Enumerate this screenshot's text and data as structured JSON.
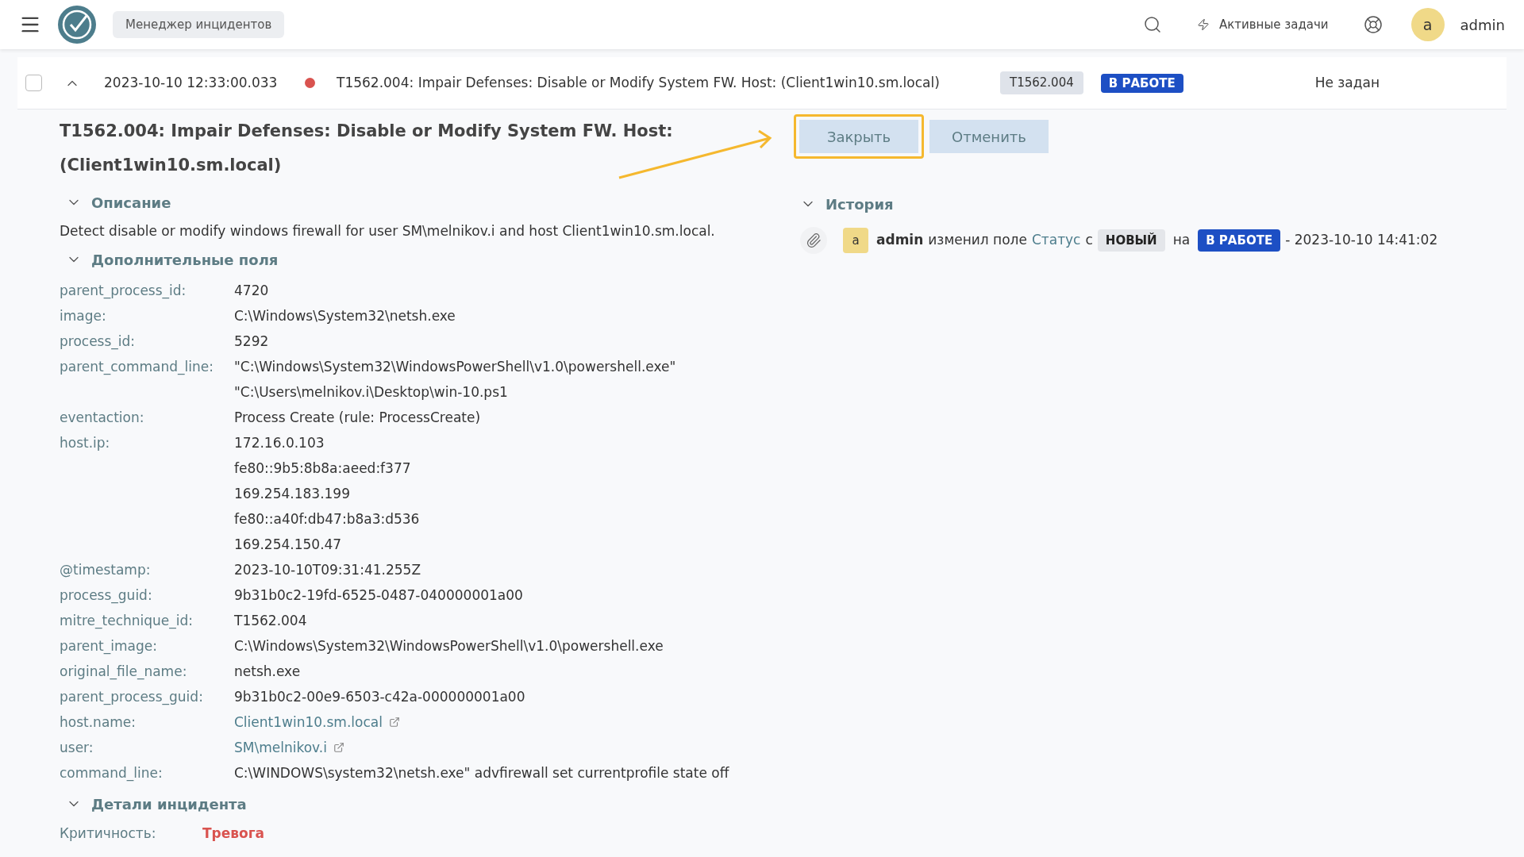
{
  "top_bar": {
    "app_title": "Менеджер инцидентов",
    "active_tasks": "Активные задачи",
    "user": {
      "initial": "a",
      "name": "admin"
    }
  },
  "incident_row": {
    "selected": false,
    "expanded": true,
    "time": "2023-10-10 12:33:00.033",
    "color": "#d9534f",
    "title": "T1562.004: Impair Defenses: Disable or Modify System FW. Host: (Client1win10.sm.local)",
    "tag": "T1562.004",
    "status": {
      "text": "В РАБОТЕ",
      "kind": "in_progress"
    },
    "assignee": "Не задан"
  },
  "detail": {
    "title_lines": [
      "T1562.004: Impair Defenses: Disable or Modify System FW. Host:",
      "(Client1win10.sm.local)"
    ],
    "buttons": [
      {
        "label": "Закрыть",
        "highlighted": true
      },
      {
        "label": "Отменить",
        "highlighted": false
      }
    ],
    "description": {
      "heading": "Описание",
      "expanded": true,
      "text": "Detect disable or modify windows firewall for user SM\\melnikov.i and host Client1win10.sm.local."
    },
    "extra_fields": {
      "heading": "Дополнительные поля",
      "expanded": true,
      "fields": [
        {
          "label": "parent_process_id:",
          "kind": "text",
          "values": [
            "4720"
          ]
        },
        {
          "label": "image:",
          "kind": "text",
          "values": [
            "C:\\Windows\\System32\\netsh.exe"
          ]
        },
        {
          "label": "process_id:",
          "kind": "text",
          "values": [
            "5292"
          ]
        },
        {
          "label": "parent_command_line:",
          "kind": "text",
          "values": [
            "\"C:\\Windows\\System32\\WindowsPowerShell\\v1.0\\powershell.exe\"",
            "\"C:\\Users\\melnikov.i\\Desktop\\win-10.ps1"
          ]
        },
        {
          "label": "eventaction:",
          "kind": "text",
          "values": [
            "Process Create (rule: ProcessCreate)"
          ]
        },
        {
          "label": "host.ip:",
          "kind": "text",
          "values": [
            "172.16.0.103",
            "fe80::9b5:8b8a:aeed:f377",
            "169.254.183.199",
            "fe80::a40f:db47:b8a3:d536",
            "169.254.150.47"
          ]
        },
        {
          "label": "@timestamp:",
          "kind": "text",
          "values": [
            "2023-10-10T09:31:41.255Z"
          ]
        },
        {
          "label": "process_guid:",
          "kind": "text",
          "values": [
            "9b31b0c2-19fd-6525-0487-040000001a00"
          ]
        },
        {
          "label": "mitre_technique_id:",
          "kind": "text",
          "values": [
            "T1562.004"
          ]
        },
        {
          "label": "parent_image:",
          "kind": "text",
          "values": [
            "C:\\Windows\\System32\\WindowsPowerShell\\v1.0\\powershell.exe"
          ]
        },
        {
          "label": "original_file_name:",
          "kind": "text",
          "values": [
            "netsh.exe"
          ]
        },
        {
          "label": "parent_process_guid:",
          "kind": "text",
          "values": [
            "9b31b0c2-00e9-6503-c42a-000000001a00"
          ]
        },
        {
          "label": "host.name:",
          "kind": "link",
          "values": [
            "Client1win10.sm.local"
          ]
        },
        {
          "label": "user:",
          "kind": "link",
          "values": [
            "SM\\melnikov.i"
          ]
        },
        {
          "label": "command_line:",
          "kind": "text",
          "values": [
            "C:\\WINDOWS\\system32\\netsh.exe\" advfirewall set currentprofile state off"
          ]
        }
      ]
    },
    "incident_details": {
      "heading": "Детали инцидента",
      "expanded": true,
      "fields": [
        {
          "label": "Критичность:",
          "value": "Тревога"
        }
      ]
    },
    "history": {
      "heading": "История",
      "expanded": true,
      "entries": [
        {
          "initial": "a",
          "user": "admin",
          "action": "изменил поле",
          "field": "Статус",
          "from_word": "с",
          "from": {
            "text": "НОВЫЙ",
            "kind": "new"
          },
          "to_word": "на",
          "to": {
            "text": "В РАБОТЕ",
            "kind": "in_progress"
          },
          "time": "- 2023-10-10 14:41:02"
        }
      ]
    }
  }
}
